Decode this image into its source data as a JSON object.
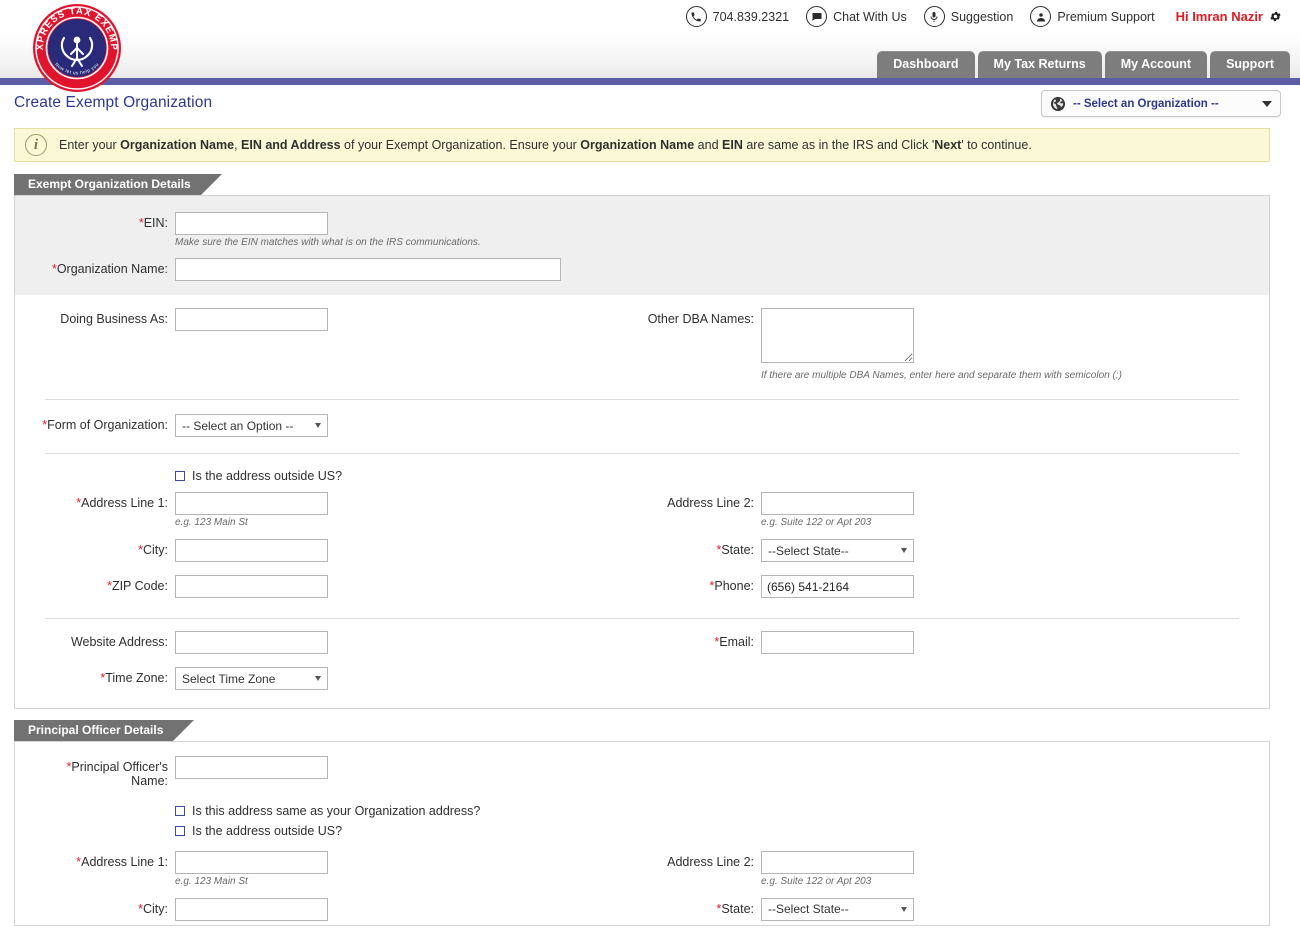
{
  "header": {
    "logo_alt": "Express Tax Exempt",
    "logo_ring_text": "EXPRESS TAX EXEMPT",
    "logo_tagline": "Now let us help you",
    "links": [
      {
        "icon": "phone-icon",
        "label": "704.839.2321"
      },
      {
        "icon": "chat-icon",
        "label": "Chat With Us"
      },
      {
        "icon": "microphone-icon",
        "label": "Suggestion"
      },
      {
        "icon": "user-support-icon",
        "label": "Premium Support"
      }
    ],
    "user_greeting": "Hi Imran Nazir",
    "settings_icon": "gear-icon",
    "nav_tabs": [
      {
        "label": "Dashboard"
      },
      {
        "label": "My Tax Returns"
      },
      {
        "label": "My Account"
      },
      {
        "label": "Support"
      }
    ]
  },
  "page": {
    "title": "Create Exempt Organization",
    "org_selector": {
      "icon": "globe-icon",
      "value": "-- Select an Organization --",
      "caret": "chevron-down-icon"
    }
  },
  "info_banner": {
    "icon": "info-icon",
    "part1": "Enter your ",
    "b1": "Organization Name",
    "part2": ", ",
    "b2": "EIN and Address",
    "part3": " of your Exempt Organization. Ensure your ",
    "b3": "Organization Name",
    "part4": " and ",
    "b4": "EIN",
    "part5": " are same as in the IRS and Click '",
    "b5": "Next",
    "part6": "' to continue."
  },
  "sections": {
    "org": {
      "title": "Exempt Organization Details",
      "ein": {
        "label": "EIN:",
        "required": true,
        "value": "",
        "hint": "Make sure the EIN matches with what is on the IRS communications."
      },
      "org_name": {
        "label": "Organization Name:",
        "required": true,
        "value": ""
      },
      "dba": {
        "label": "Doing Business As:",
        "required": false,
        "value": ""
      },
      "other_dba": {
        "label": "Other DBA Names:",
        "required": false,
        "value": "",
        "hint": "If there are multiple DBA Names, enter here and separate them with semicolon (;)"
      },
      "form_of_org": {
        "label": "Form of Organization:",
        "required": true,
        "value": "-- Select an Option --"
      },
      "outside_us": {
        "label": "Is the address outside US?",
        "checked": false
      },
      "address1": {
        "label": "Address Line 1:",
        "required": true,
        "value": "",
        "hint": "e.g. 123 Main St"
      },
      "address2": {
        "label": "Address Line 2:",
        "required": false,
        "value": "",
        "hint": "e.g. Suite 122 or Apt 203"
      },
      "city": {
        "label": "City:",
        "required": true,
        "value": ""
      },
      "state": {
        "label": "State:",
        "required": true,
        "value": "--Select State--"
      },
      "zip": {
        "label": "ZIP Code:",
        "required": true,
        "value": ""
      },
      "phone": {
        "label": "Phone:",
        "required": true,
        "value": "(656) 541-2164"
      },
      "website": {
        "label": "Website Address:",
        "required": false,
        "value": ""
      },
      "email": {
        "label": "Email:",
        "required": true,
        "value": ""
      },
      "timezone": {
        "label": "Time Zone:",
        "required": true,
        "value": "Select Time Zone"
      }
    },
    "officer": {
      "title": "Principal Officer Details",
      "name": {
        "label_line1": "Principal Officer's",
        "label_line2": "Name:",
        "required": true,
        "value": ""
      },
      "same_address": {
        "label": "Is this address same as your Organization address?",
        "checked": false
      },
      "outside_us": {
        "label": "Is the address outside US?",
        "checked": false
      },
      "address1": {
        "label": "Address Line 1:",
        "required": true,
        "value": "",
        "hint": "e.g. 123 Main St"
      },
      "address2": {
        "label": "Address Line 2:",
        "required": false,
        "value": "",
        "hint": "e.g. Suite 122 or Apt 203"
      },
      "city": {
        "label": "City:",
        "required": true,
        "value": ""
      },
      "state": {
        "label": "State:",
        "required": true,
        "value": "--Select State--"
      }
    }
  },
  "colors": {
    "brand_navy": "#2b3990",
    "brand_red": "#e11b22",
    "accent_bar": "#5b5ea6",
    "tab_gray": "#7d7d7d",
    "banner_bg": "#fbf8d6"
  }
}
